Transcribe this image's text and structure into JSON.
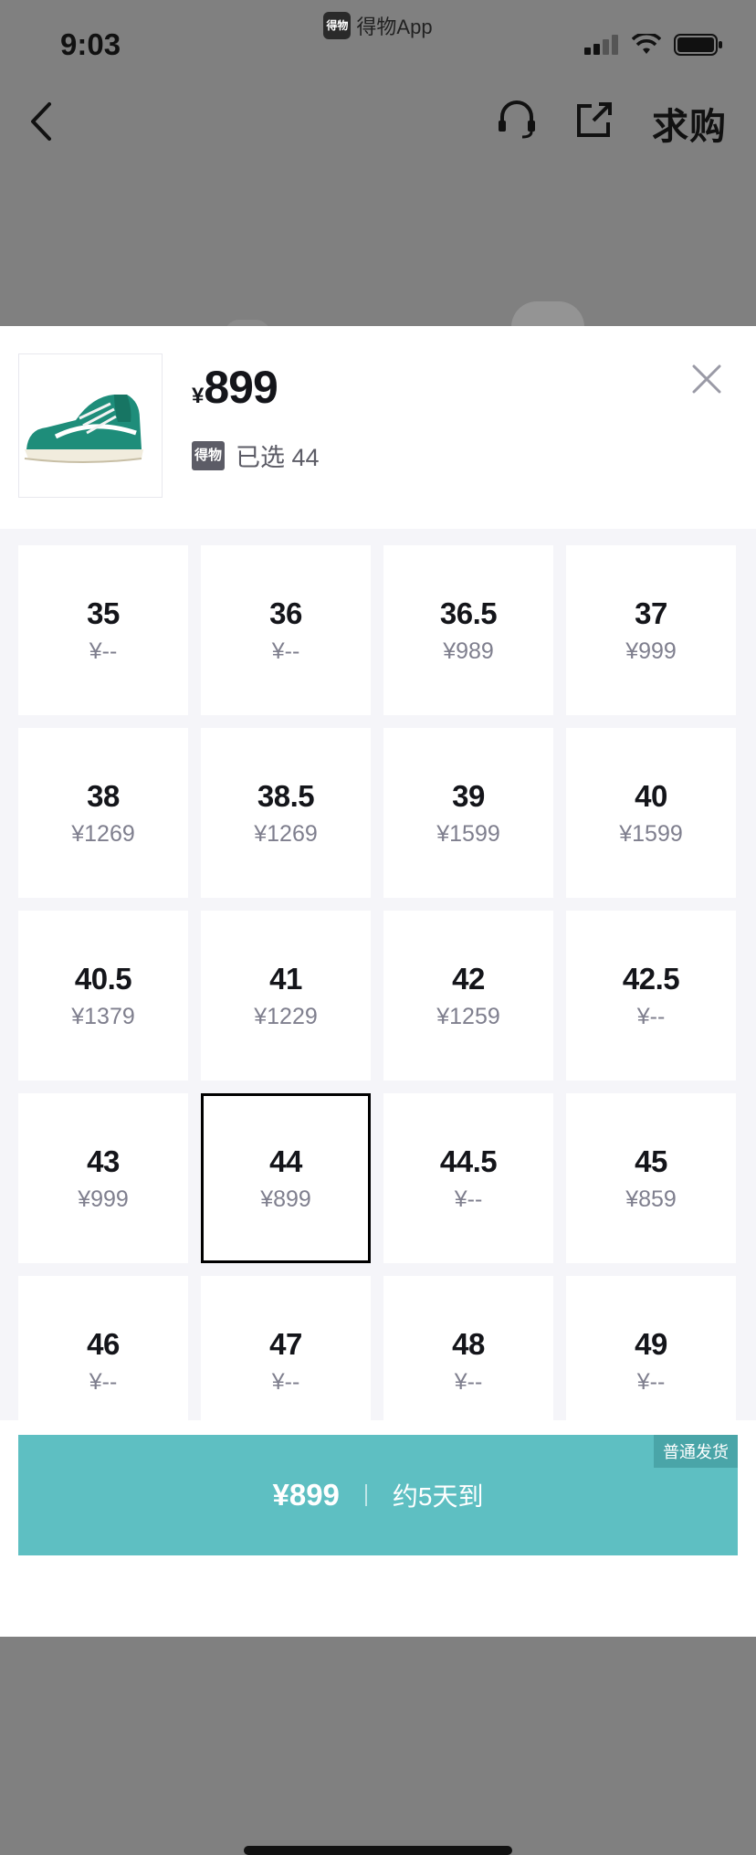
{
  "status_bar": {
    "time": "9:03",
    "app_name": "得物App",
    "app_badge": "得物"
  },
  "nav": {
    "want_buy_label": "求购"
  },
  "sheet": {
    "price_symbol": "¥",
    "price": "899",
    "badge": "得物",
    "selected_label": "已选 44",
    "sizes": [
      {
        "size": "35",
        "price": "¥--"
      },
      {
        "size": "36",
        "price": "¥--"
      },
      {
        "size": "36.5",
        "price": "¥989"
      },
      {
        "size": "37",
        "price": "¥999"
      },
      {
        "size": "38",
        "price": "¥1269"
      },
      {
        "size": "38.5",
        "price": "¥1269"
      },
      {
        "size": "39",
        "price": "¥1599"
      },
      {
        "size": "40",
        "price": "¥1599"
      },
      {
        "size": "40.5",
        "price": "¥1379"
      },
      {
        "size": "41",
        "price": "¥1229"
      },
      {
        "size": "42",
        "price": "¥1259"
      },
      {
        "size": "42.5",
        "price": "¥--"
      },
      {
        "size": "43",
        "price": "¥999"
      },
      {
        "size": "44",
        "price": "¥899"
      },
      {
        "size": "44.5",
        "price": "¥--"
      },
      {
        "size": "45",
        "price": "¥859"
      },
      {
        "size": "46",
        "price": "¥--"
      },
      {
        "size": "47",
        "price": "¥--"
      },
      {
        "size": "48",
        "price": "¥--"
      },
      {
        "size": "49",
        "price": "¥--"
      }
    ],
    "selected_size": "44"
  },
  "buy_bar": {
    "price": "¥899",
    "eta": "约5天到",
    "ship_tag": "普通发货"
  },
  "colors": {
    "accent": "#5ebfc2",
    "accent_dark": "#4aa5a8",
    "text": "#14151a",
    "muted": "#7f7f8e"
  },
  "icons": [
    "back-icon",
    "customer-service-icon",
    "share-icon",
    "close-icon"
  ]
}
